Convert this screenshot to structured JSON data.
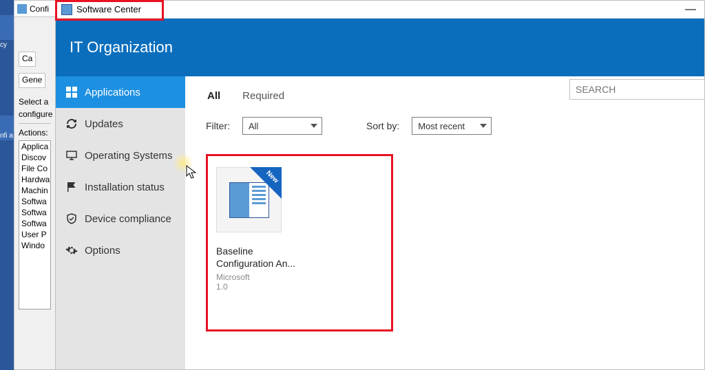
{
  "desktop": {
    "icon1_label": "cy",
    "icon2_label": "nfi\na"
  },
  "backwin": {
    "title": "Confi",
    "tab_cache": "Ca",
    "tab_general": "Gene",
    "select_line1": "Select a",
    "select_line2": "configure",
    "actions_label": "Actions:",
    "items": [
      "Applica",
      "Discov",
      "File Co",
      "Hardwa",
      "Machin",
      "Softwa",
      "Softwa",
      "Softwa",
      "User P",
      "Windo"
    ]
  },
  "sc": {
    "title": "Software Center",
    "brand": "IT Organization",
    "minimize": "—",
    "sidebar": [
      {
        "key": "applications",
        "label": "Applications"
      },
      {
        "key": "updates",
        "label": "Updates"
      },
      {
        "key": "os",
        "label": "Operating Systems"
      },
      {
        "key": "install",
        "label": "Installation status"
      },
      {
        "key": "device",
        "label": "Device compliance"
      },
      {
        "key": "options",
        "label": "Options"
      }
    ],
    "tabs": {
      "all": "All",
      "required": "Required"
    },
    "filter": {
      "label": "Filter:",
      "value": "All"
    },
    "sort": {
      "label": "Sort by:",
      "value": "Most recent"
    },
    "search_placeholder": "SEARCH",
    "app": {
      "ribbon": "New",
      "title_line1": "Baseline",
      "title_line2": "Configuration An...",
      "publisher": "Microsoft",
      "version": "1.0"
    }
  }
}
